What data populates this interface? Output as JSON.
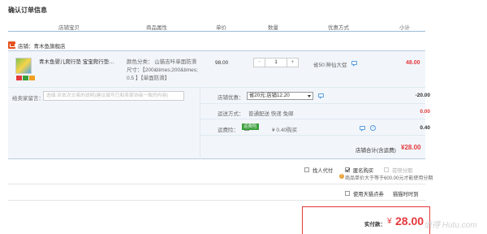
{
  "page": {
    "title": "确认订单信息"
  },
  "table_header": {
    "columns": [
      "店铺宝贝",
      "商品属性",
      "单价",
      "数量",
      "优惠方式",
      "小计"
    ]
  },
  "shop": {
    "label": "店铺：",
    "name": "青木鱼旗舰店"
  },
  "item": {
    "title_line1": "青木鱼婴儿爬行垫 宝宝爬行垫…",
    "attr_line1": "颜色分类：  山猫吉咔单面防滑",
    "attr_line2": "尺寸：【200&times;200&times;",
    "attr_line3": "0.5 】【单面防滑】",
    "unit_price": "98.00",
    "quantity": "1",
    "minus": "-",
    "plus": "+",
    "promotion": "省50:神仙大促",
    "subtotal": "48.00"
  },
  "options": {
    "message_label": "给卖家留言：",
    "message_placeholder": "选填:对本次交易的说明(建议填写已和卖家协商一致的内容)",
    "shop_discount_label": "店铺优惠：",
    "shop_discount_selected": "省20元:店铺12.20",
    "shop_discount_amount": "-20.00",
    "shipping_label": "运送方式：",
    "shipping_value": "普通配送 快递 免邮",
    "shipping_amount": "0.00",
    "insurance_label": "运费险：",
    "insurance_tag": "运费险",
    "insurance_value": "¥ 0.40购买",
    "insurance_amount": "0.40",
    "shop_total_label": "店铺合计(含运费)",
    "shop_total": "¥28.00"
  },
  "payment_options": {
    "proxy_pay": "找人代付",
    "anonymous": "匿名购买",
    "huabei": "花呗分期",
    "note": "商品单价大于等于600.00元才能使用分期",
    "tmall_points": "使用天猫点券",
    "points_rule": "猫猫时时到"
  },
  "pay": {
    "label": "实付款：",
    "currency": "¥",
    "amount": "28.00"
  },
  "watermark": "值得 Hutu.com",
  "colors": {
    "accent_red": "#e4393c",
    "panel_blue": "#f2f6fb",
    "header_line": "#9bbbd6"
  }
}
